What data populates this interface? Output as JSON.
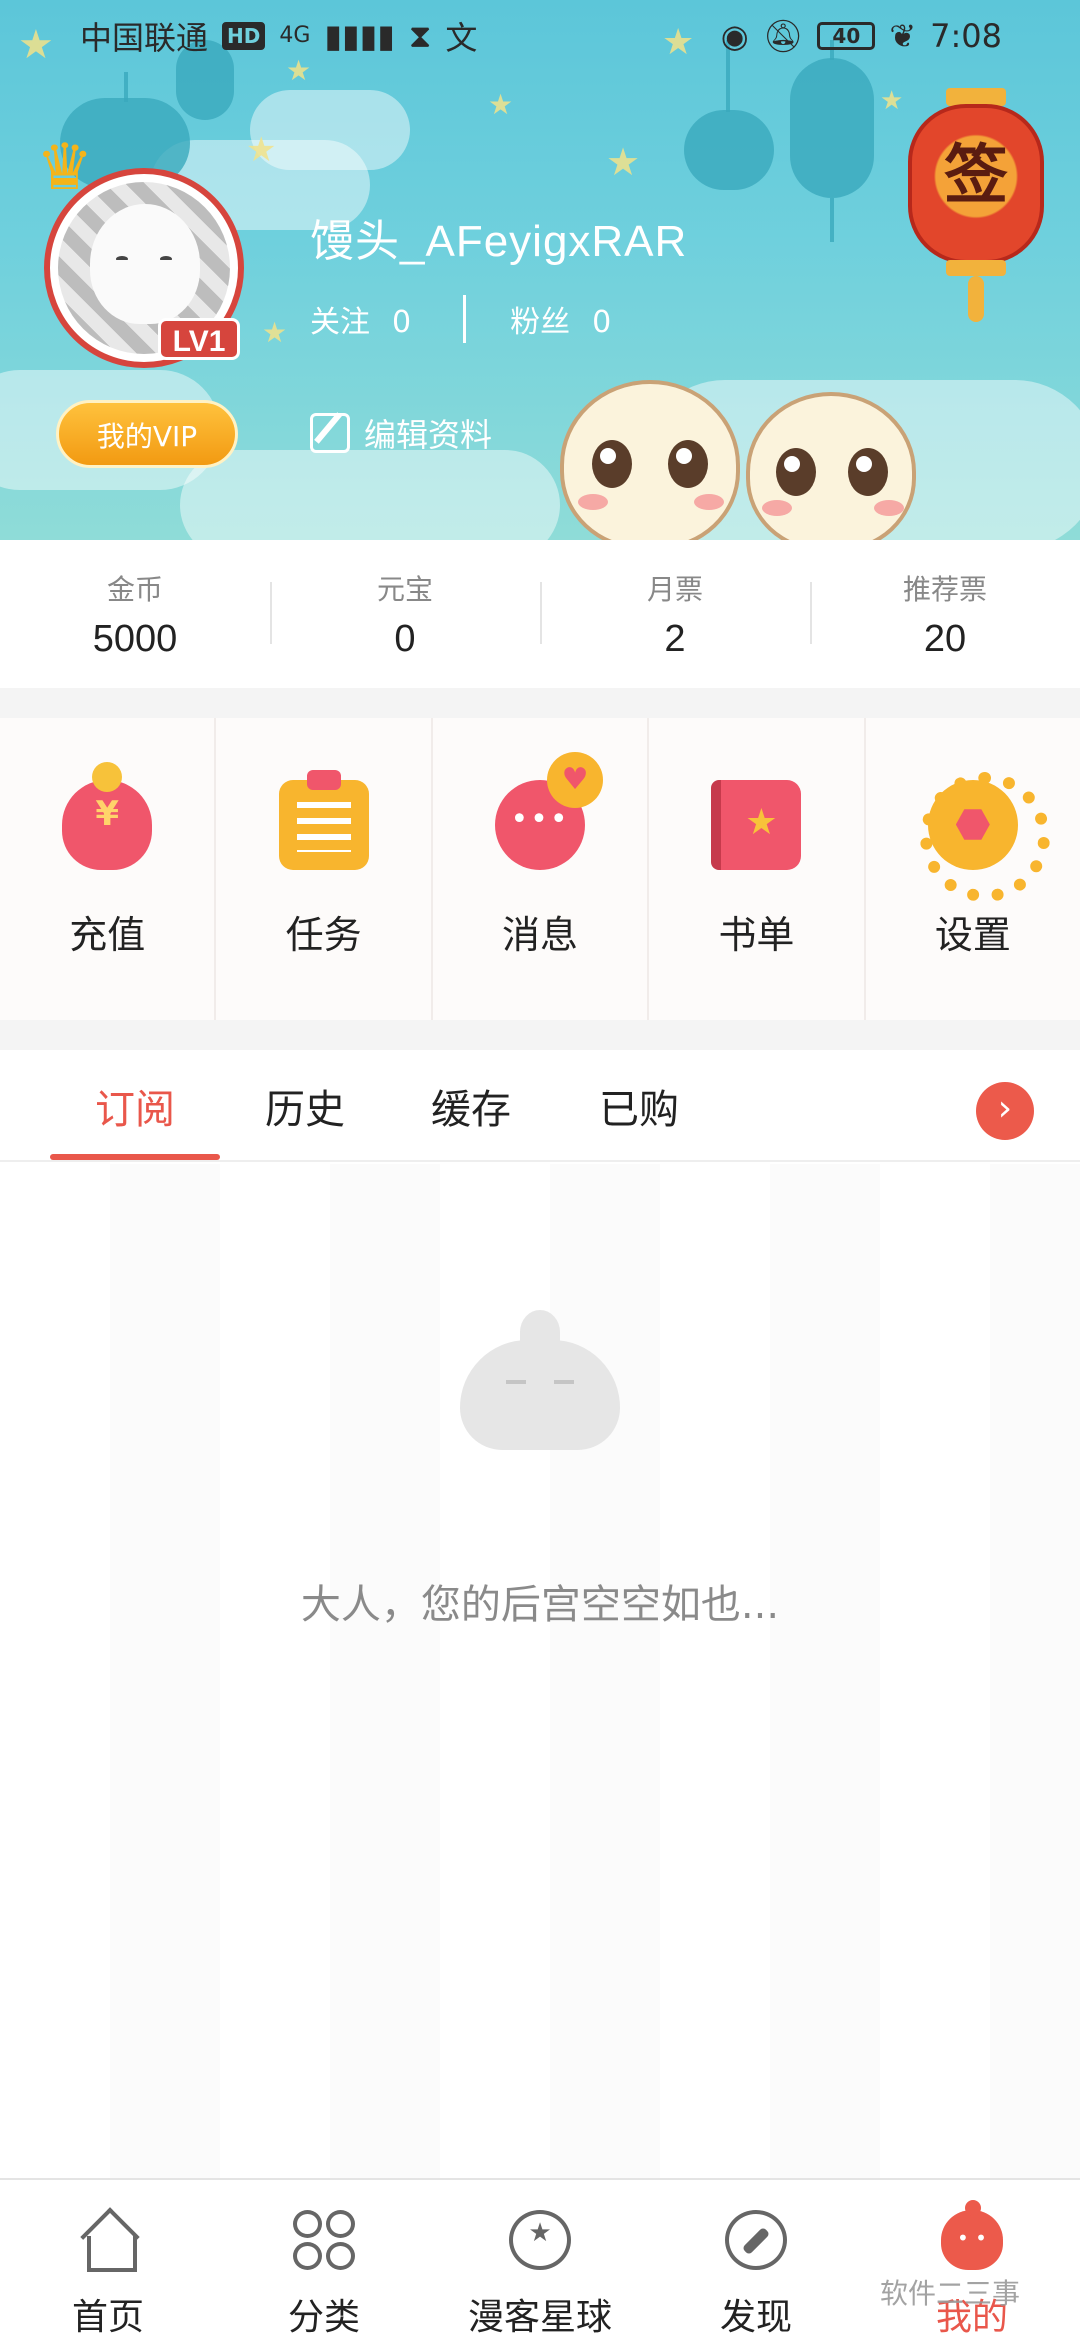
{
  "status_bar": {
    "carrier": "中国联通",
    "hd": "HD",
    "network": "4G",
    "battery": "40",
    "time": "7:08"
  },
  "profile": {
    "username": "馒头_AFeyigxRAR",
    "level": "LV1",
    "follow_label": "关注",
    "follow_count": "0",
    "fans_label": "粉丝",
    "fans_count": "0",
    "vip_label": "我的VIP",
    "edit_label": "编辑资料",
    "sign_label": "签"
  },
  "stats": [
    {
      "label": "金币",
      "value": "5000"
    },
    {
      "label": "元宝",
      "value": "0"
    },
    {
      "label": "月票",
      "value": "2"
    },
    {
      "label": "推荐票",
      "value": "20"
    }
  ],
  "quick_menu": [
    {
      "label": "充值",
      "icon": "piggy-bank-icon"
    },
    {
      "label": "任务",
      "icon": "clipboard-icon"
    },
    {
      "label": "消息",
      "icon": "message-bubble-icon"
    },
    {
      "label": "书单",
      "icon": "book-icon"
    },
    {
      "label": "设置",
      "icon": "gear-icon"
    }
  ],
  "tabs": [
    {
      "label": "订阅",
      "active": true
    },
    {
      "label": "历史",
      "active": false
    },
    {
      "label": "缓存",
      "active": false
    },
    {
      "label": "已购",
      "active": false
    }
  ],
  "empty_state": {
    "message": "大人，您的后宫空空如也..."
  },
  "bottom_nav": [
    {
      "label": "首页",
      "icon": "home-icon"
    },
    {
      "label": "分类",
      "icon": "category-icon"
    },
    {
      "label": "漫客星球",
      "icon": "planet-icon"
    },
    {
      "label": "发现",
      "icon": "compass-icon"
    },
    {
      "label": "我的",
      "icon": "mine-mascot-icon",
      "active": true
    }
  ],
  "watermark": "软件二三事",
  "colors": {
    "accent": "#e9574b",
    "header_top": "#5cc6d9",
    "vip_orange": "#f29a12"
  }
}
